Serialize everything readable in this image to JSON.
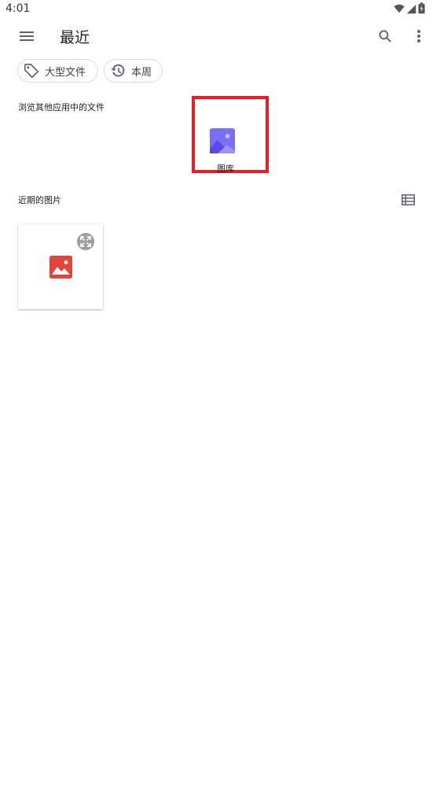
{
  "status_bar": {
    "time": "4:01",
    "icons": [
      "wifi-icon",
      "signal-icon",
      "battery-icon"
    ]
  },
  "toolbar": {
    "title": "最近",
    "icons": [
      "menu-icon",
      "search-icon",
      "more-vert-icon"
    ]
  },
  "chips": [
    {
      "label": "大型文件",
      "icon": "tag-icon"
    },
    {
      "label": "本周",
      "icon": "history-icon"
    }
  ],
  "browse_section": {
    "label": "浏览其他应用中的文件",
    "apps": [
      {
        "label": "图库",
        "icon": "gallery-icon"
      }
    ]
  },
  "recent_section": {
    "label": "近期的图片",
    "view_toggle_icon": "list-view-icon",
    "items": [
      {
        "icon": "image-icon",
        "action_icon": "expand-icon"
      }
    ]
  },
  "colors": {
    "highlight": "#e4212a",
    "gallery_icon": "#7b6ef6",
    "image_icon": "#e0463c",
    "expand_icon_bg": "#9e9e9e"
  }
}
